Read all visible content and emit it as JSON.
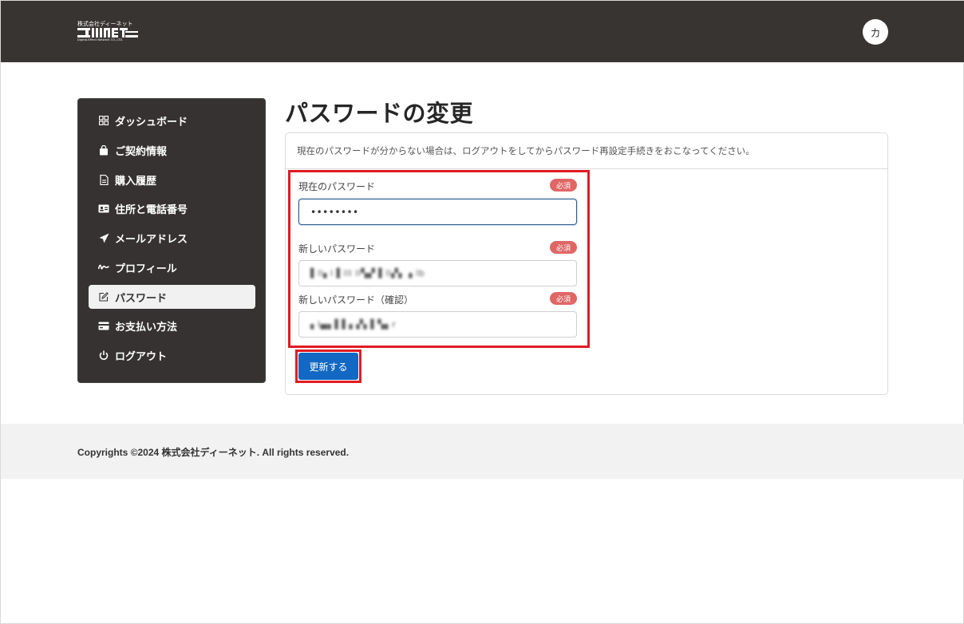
{
  "header": {
    "logo_company": "株式会社ディーネット",
    "logo_mark": "Deinet",
    "logo_sub": "Digital-Effect Network CO.,LTD.",
    "avatar_initial": "カ"
  },
  "sidebar": {
    "items": [
      {
        "label": "ダッシュボード",
        "icon": "dashboard-icon",
        "active": false
      },
      {
        "label": "ご契約情報",
        "icon": "bag-icon",
        "active": false
      },
      {
        "label": "購入履歴",
        "icon": "document-icon",
        "active": false
      },
      {
        "label": "住所と電話番号",
        "icon": "id-card-icon",
        "active": false
      },
      {
        "label": "メールアドレス",
        "icon": "paper-plane-icon",
        "active": false
      },
      {
        "label": "プロフィール",
        "icon": "signature-icon",
        "active": false
      },
      {
        "label": "パスワード",
        "icon": "edit-icon",
        "active": true
      },
      {
        "label": "お支払い方法",
        "icon": "credit-card-icon",
        "active": false
      },
      {
        "label": "ログアウト",
        "icon": "power-icon",
        "active": false
      }
    ]
  },
  "main": {
    "title": "パスワードの変更",
    "notice": "現在のパスワードが分からない場合は、ログアウトをしてからパスワード再設定手続きをおこなってください。",
    "fields": {
      "current": {
        "label": "現在のパスワード",
        "badge": "必須",
        "value": "••••••••"
      },
      "new": {
        "label": "新しいパスワード",
        "badge": "必須",
        "value": "▌ll▖l ▌lll ll▚▞ ▌ll▞▖ ▖lb"
      },
      "confirm": {
        "label": "新しいパスワード（確認）",
        "badge": "必須",
        "value": "▖l▄▖▌▌▖▞▖▌▚▖r"
      }
    },
    "submit_label": "更新する"
  },
  "footer": {
    "copyright": "Copyrights ©2024 株式会社ディーネット. All rights reserved."
  },
  "colors": {
    "header_bg": "#383432",
    "sidebar_bg": "#353231",
    "primary": "#1268c2",
    "required_badge": "#e06666",
    "highlight": "#e01b24"
  }
}
